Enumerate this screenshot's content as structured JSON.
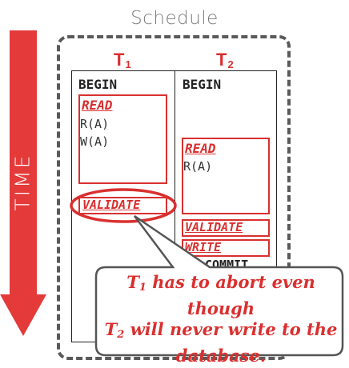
{
  "title": "Schedule",
  "time_label": "TIME",
  "transactions": [
    {
      "id": "T",
      "sub": "1"
    },
    {
      "id": "T",
      "sub": "2"
    }
  ],
  "t1": {
    "begin": "BEGIN",
    "read_phase": "READ",
    "ops": [
      "R(A)",
      "W(A)"
    ],
    "validate": "VALIDATE"
  },
  "t2": {
    "begin": "BEGIN",
    "read_phase": "READ",
    "ops": [
      "R(A)"
    ],
    "validate": "VALIDATE",
    "write": "WRITE",
    "commit": "COMMIT"
  },
  "callout": {
    "line1_subject": "T",
    "line1_sub": "1",
    "line1_rest": " has to abort even though",
    "line2_subject": "T",
    "line2_sub": "2",
    "line2_rest": " will never write to the",
    "line3": "database."
  },
  "colors": {
    "accent": "#d9302f",
    "arrow": "#e43a3a",
    "frame": "#5a5a5a",
    "title": "#7a7a7a"
  }
}
